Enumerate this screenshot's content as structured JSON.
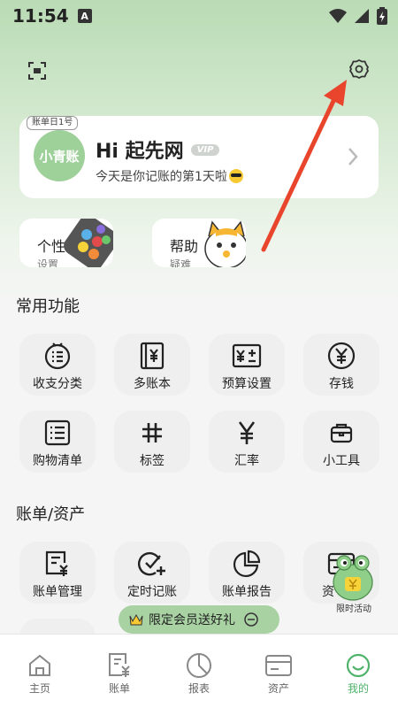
{
  "status_bar": {
    "time": "11:54",
    "notif_icon": "A"
  },
  "profile": {
    "tag": "账单日1号",
    "avatar_text": "小青账",
    "name": "Hi 起先网",
    "vip": "VIP",
    "subtitle": "今天是你记账的第1天啦"
  },
  "cards": {
    "personalize": {
      "label": "个性化",
      "sub": "设置"
    },
    "help": {
      "label": "帮助",
      "sub": "疑难"
    }
  },
  "sections": {
    "common": "常用功能",
    "bills": "账单/资产"
  },
  "common_items": [
    "收支分类",
    "多账本",
    "预算设置",
    "存钱",
    "购物清单",
    "标签",
    "汇率",
    "小工具"
  ],
  "bill_items": [
    "账单管理",
    "定时记账",
    "账单报告",
    "资"
  ],
  "promo": {
    "text": "限定会员送好礼"
  },
  "floating": {
    "label": "限时活动"
  },
  "tabs": [
    "主页",
    "账单",
    "报表",
    "资产",
    "我的"
  ],
  "colors": {
    "accent": "#4fb26a",
    "card_bg": "#ffffff",
    "grid_bg": "#eeefee",
    "arrow": "#e8452c",
    "promo": "#a8d2a2"
  }
}
